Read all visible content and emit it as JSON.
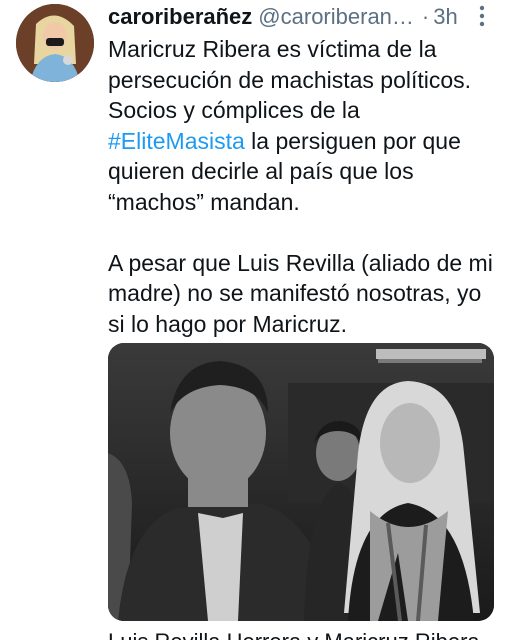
{
  "tweet": {
    "display_name": "caroriberañez",
    "handle": "@caroriberan…",
    "separator": "·",
    "time": "3h",
    "text_lines": [
      "Maricruz Ribera es víctima de la",
      "persecución de machistas políticos.",
      "Socios y cómplices de la"
    ],
    "hashtag": "#EliteMasista",
    "hashtag_rest": " la persiguen por que",
    "text_lines_2": [
      "quieren decirle al país que los",
      "“machos” mandan."
    ],
    "paragraph2": [
      "A pesar que Luis Revilla (aliado de mi",
      "madre) no se manifestó nosotras, yo",
      "si lo hago por Maricruz."
    ],
    "media_caption": "Luis Revilla Herrera y Maricruz Ribera"
  },
  "icons": {
    "more": "more-vertical-icon"
  },
  "colors": {
    "text": "#0f1419",
    "secondary": "#5b7083",
    "link": "#1d9bf0"
  }
}
